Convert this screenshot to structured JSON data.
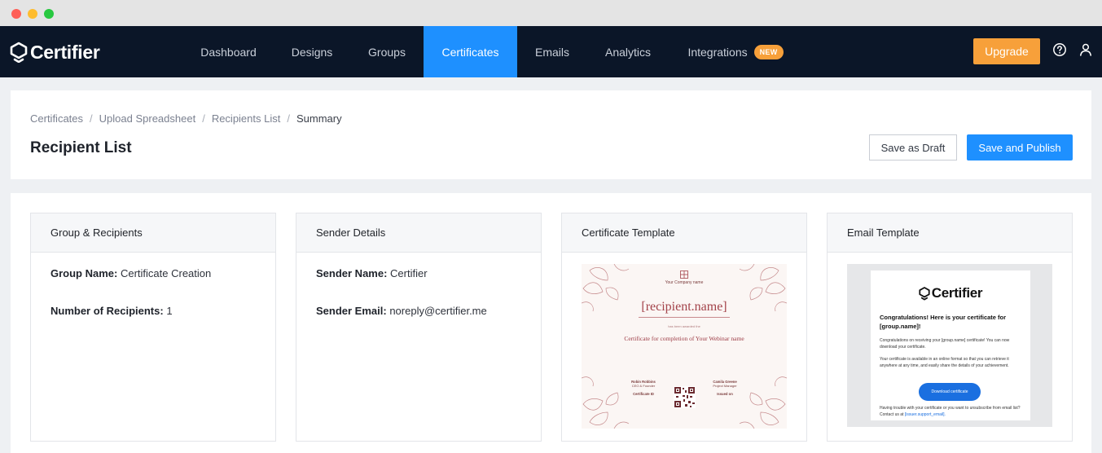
{
  "nav": {
    "brand": "Certifier",
    "items": [
      {
        "label": "Dashboard"
      },
      {
        "label": "Designs"
      },
      {
        "label": "Groups"
      },
      {
        "label": "Certificates"
      },
      {
        "label": "Emails"
      },
      {
        "label": "Analytics"
      },
      {
        "label": "Integrations",
        "badge": "NEW"
      }
    ],
    "active_item": "Certificates",
    "upgrade_label": "Upgrade",
    "help_icon": "help-circle-icon",
    "user_icon": "user-icon",
    "active_color": "#1e90ff",
    "accent_color": "#f7a03a"
  },
  "breadcrumb": [
    "Certificates",
    "Upload Spreadsheet",
    "Recipients List",
    "Summary"
  ],
  "page": {
    "title": "Recipient List",
    "save_draft_label": "Save as Draft",
    "save_publish_label": "Save and Publish"
  },
  "panels": {
    "group": {
      "title": "Group & Recipients",
      "group_name_label": "Group Name:",
      "group_name": "Certificate Creation",
      "recipients_label": "Number of Recipients:",
      "recipients_count": "1"
    },
    "sender": {
      "title": "Sender Details",
      "name_label": "Sender Name:",
      "name": "Certifier",
      "email_label": "Sender Email:",
      "email": "noreply@certifier.me"
    },
    "certificate": {
      "title": "Certificate Template",
      "company": "Your Company name",
      "recipient": "[recipient.name]",
      "presented": "has been awarded the",
      "title_text": "Certificate for completion of Your Webinar name",
      "sig_left_name": "Robin Robbins",
      "sig_left_role": "CEO & Founder",
      "sig_right_name": "Camila Greene",
      "sig_right_role": "Project Manager",
      "cert_id_label": "Certificate ID",
      "issued_on_label": "Issued on"
    },
    "email": {
      "title": "Email Template",
      "brand": "Certifier",
      "heading": "Congratulations! Here is your certificate for [group.name]!",
      "p1": "Congratulations on receiving your [group.name] certificate! You can now download your certificate.",
      "p2": "Your certificate is available in an online format so that you can retrieve it anywhere at any time, and easily share the details of your achievement.",
      "button": "Download certificate",
      "footer": "Having trouble with your certificate or you want to unsubscribe from email list? Contact us at",
      "footer_link": "[issuer.support_email]."
    }
  }
}
